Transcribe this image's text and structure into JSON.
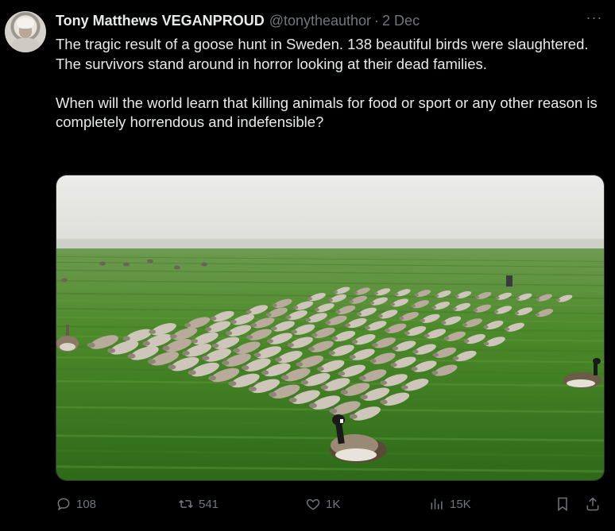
{
  "tweet": {
    "display_name": "Tony Matthews VEGANPROUD",
    "handle": "@tonytheauthor",
    "separator": "·",
    "time": "2 Dec",
    "more_label": "···",
    "paragraphs": [
      "The tragic result of a goose hunt in Sweden. 138 beautiful birds were slaughtered. The survivors stand around in horror looking at their dead families.",
      "When will the world learn that killing animals for food or sport or any other reason is completely horrendous and indefensible?"
    ]
  },
  "media": {
    "description_icon": "photo",
    "colors": {
      "sky": "#e7e7e5",
      "field": "#4f8a2e",
      "field_dark": "#2f6a1c"
    }
  },
  "actions": {
    "replies": "108",
    "reposts": "541",
    "likes": "1K",
    "views": "15K"
  },
  "icons": {
    "reply": "reply-icon",
    "repost": "repost-icon",
    "like": "heart-icon",
    "views": "views-icon",
    "bookmark": "bookmark-icon",
    "share": "share-icon"
  },
  "theme": {
    "background": "#000000",
    "text": "#e7e9ea",
    "muted": "#71767b"
  }
}
